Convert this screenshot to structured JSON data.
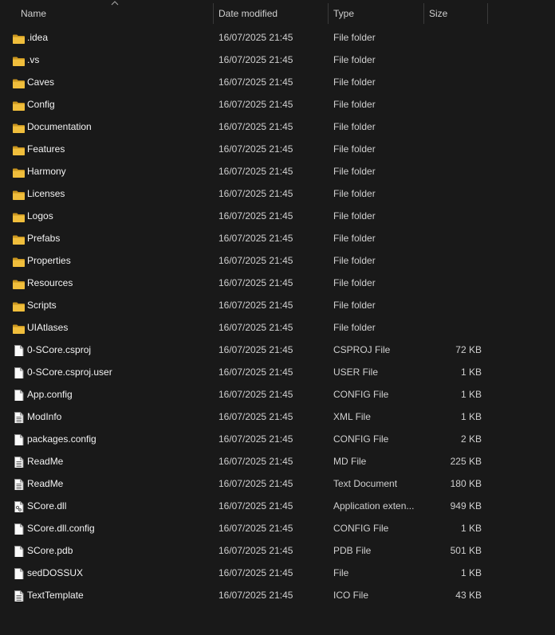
{
  "columns": {
    "name": "Name",
    "date": "Date modified",
    "type": "Type",
    "size": "Size"
  },
  "files": [
    {
      "name": ".idea",
      "date": "16/07/2025 21:45",
      "type": "File folder",
      "size": "",
      "icon": "folder-icon"
    },
    {
      "name": ".vs",
      "date": "16/07/2025 21:45",
      "type": "File folder",
      "size": "",
      "icon": "folder-icon"
    },
    {
      "name": "Caves",
      "date": "16/07/2025 21:45",
      "type": "File folder",
      "size": "",
      "icon": "folder-icon"
    },
    {
      "name": "Config",
      "date": "16/07/2025 21:45",
      "type": "File folder",
      "size": "",
      "icon": "folder-icon"
    },
    {
      "name": "Documentation",
      "date": "16/07/2025 21:45",
      "type": "File folder",
      "size": "",
      "icon": "folder-icon"
    },
    {
      "name": "Features",
      "date": "16/07/2025 21:45",
      "type": "File folder",
      "size": "",
      "icon": "folder-icon"
    },
    {
      "name": "Harmony",
      "date": "16/07/2025 21:45",
      "type": "File folder",
      "size": "",
      "icon": "folder-icon"
    },
    {
      "name": "Licenses",
      "date": "16/07/2025 21:45",
      "type": "File folder",
      "size": "",
      "icon": "folder-icon"
    },
    {
      "name": "Logos",
      "date": "16/07/2025 21:45",
      "type": "File folder",
      "size": "",
      "icon": "folder-icon"
    },
    {
      "name": "Prefabs",
      "date": "16/07/2025 21:45",
      "type": "File folder",
      "size": "",
      "icon": "folder-icon"
    },
    {
      "name": "Properties",
      "date": "16/07/2025 21:45",
      "type": "File folder",
      "size": "",
      "icon": "folder-icon"
    },
    {
      "name": "Resources",
      "date": "16/07/2025 21:45",
      "type": "File folder",
      "size": "",
      "icon": "folder-icon"
    },
    {
      "name": "Scripts",
      "date": "16/07/2025 21:45",
      "type": "File folder",
      "size": "",
      "icon": "folder-icon"
    },
    {
      "name": "UIAtlases",
      "date": "16/07/2025 21:45",
      "type": "File folder",
      "size": "",
      "icon": "folder-icon"
    },
    {
      "name": "0-SCore.csproj",
      "date": "16/07/2025 21:45",
      "type": "CSPROJ File",
      "size": "72 KB",
      "icon": "file-icon"
    },
    {
      "name": "0-SCore.csproj.user",
      "date": "16/07/2025 21:45",
      "type": "USER File",
      "size": "1 KB",
      "icon": "file-icon"
    },
    {
      "name": "App.config",
      "date": "16/07/2025 21:45",
      "type": "CONFIG File",
      "size": "1 KB",
      "icon": "file-icon"
    },
    {
      "name": "ModInfo",
      "date": "16/07/2025 21:45",
      "type": "XML File",
      "size": "1 KB",
      "icon": "text-file-icon"
    },
    {
      "name": "packages.config",
      "date": "16/07/2025 21:45",
      "type": "CONFIG File",
      "size": "2 KB",
      "icon": "file-icon"
    },
    {
      "name": "ReadMe",
      "date": "16/07/2025 21:45",
      "type": "MD File",
      "size": "225 KB",
      "icon": "text-file-icon"
    },
    {
      "name": "ReadMe",
      "date": "16/07/2025 21:45",
      "type": "Text Document",
      "size": "180 KB",
      "icon": "text-file-icon"
    },
    {
      "name": "SCore.dll",
      "date": "16/07/2025 21:45",
      "type": "Application exten...",
      "size": "949 KB",
      "icon": "dll-file-icon"
    },
    {
      "name": "SCore.dll.config",
      "date": "16/07/2025 21:45",
      "type": "CONFIG File",
      "size": "1 KB",
      "icon": "file-icon"
    },
    {
      "name": "SCore.pdb",
      "date": "16/07/2025 21:45",
      "type": "PDB File",
      "size": "501 KB",
      "icon": "file-icon"
    },
    {
      "name": "sedDOSSUX",
      "date": "16/07/2025 21:45",
      "type": "File",
      "size": "1 KB",
      "icon": "file-icon"
    },
    {
      "name": "TextTemplate",
      "date": "16/07/2025 21:45",
      "type": "ICO File",
      "size": "43 KB",
      "icon": "text-file-icon"
    }
  ],
  "colors": {
    "background": "#191919",
    "folder": "#e8b530",
    "text": "#f2f2f2",
    "muted_text": "#cfcfcf"
  }
}
